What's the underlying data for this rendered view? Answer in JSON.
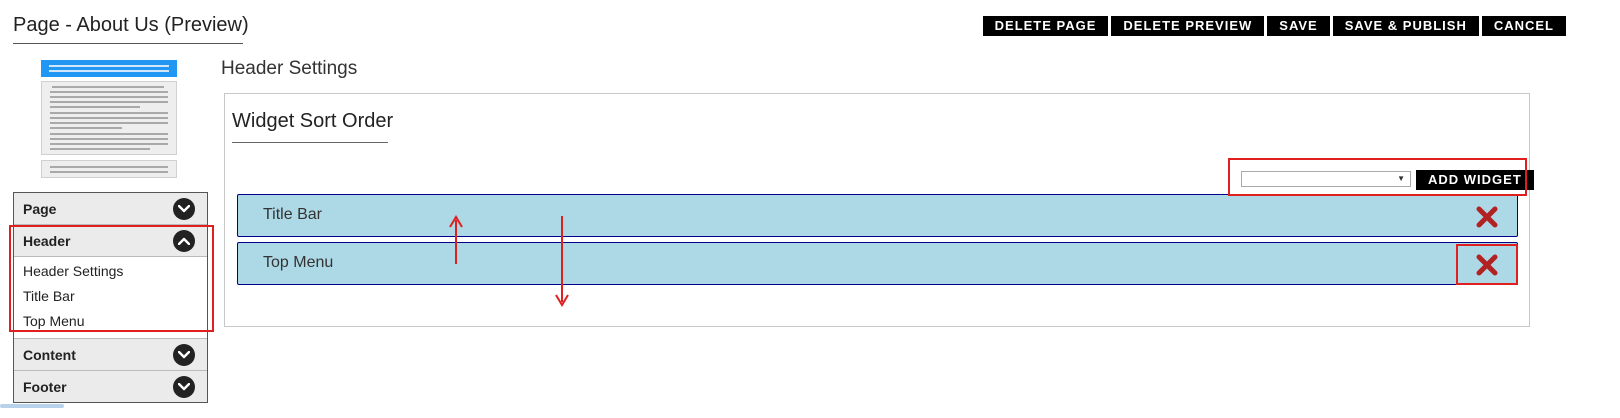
{
  "page": {
    "title": "Page - About Us (Preview)"
  },
  "actions": [
    {
      "label": "DELETE PAGE"
    },
    {
      "label": "DELETE PREVIEW"
    },
    {
      "label": "SAVE"
    },
    {
      "label": "SAVE & PUBLISH"
    },
    {
      "label": "CANCEL"
    }
  ],
  "sidebar": {
    "sections": [
      {
        "label": "Page",
        "expanded": false,
        "icon": "chevron-down-icon"
      },
      {
        "label": "Header",
        "expanded": true,
        "icon": "chevron-up-icon",
        "items": [
          {
            "label": "Header Settings"
          },
          {
            "label": "Title Bar"
          },
          {
            "label": "Top Menu"
          }
        ]
      },
      {
        "label": "Content",
        "expanded": false,
        "icon": "chevron-down-icon"
      },
      {
        "label": "Footer",
        "expanded": false,
        "icon": "chevron-down-icon"
      }
    ]
  },
  "main": {
    "section_title": "Header Settings",
    "panel_title": "Widget Sort Order",
    "widget_select": {
      "value": ""
    },
    "add_widget_label": "ADD WIDGET",
    "widgets": [
      {
        "label": "Title Bar",
        "icon": "close-icon"
      },
      {
        "label": "Top Menu",
        "icon": "close-icon"
      }
    ]
  },
  "colors": {
    "accent_blue": "#2196f3",
    "widget_bg": "#add8e6",
    "widget_border": "#00008b",
    "delete_red": "#b22222",
    "annotation_red": "#e02020",
    "button_black": "#000000"
  }
}
